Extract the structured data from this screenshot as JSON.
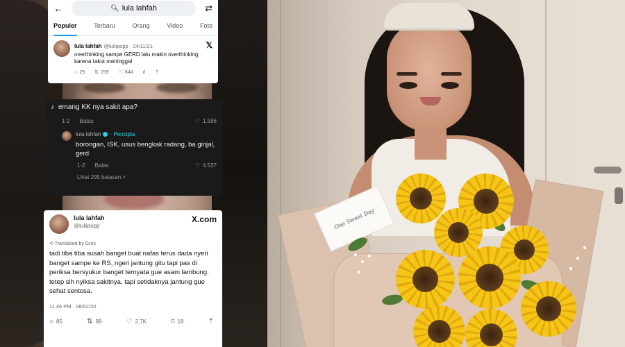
{
  "search_card": {
    "query": "lula lahfah",
    "tabs": [
      "Populer",
      "Terbaru",
      "Orang",
      "Video",
      "Foto"
    ],
    "tweet": {
      "name": "lula lahfah",
      "handle_date": "@lullipopp · 24/11/21",
      "text": "overthinking sampe GERD lalu makin overthinking karena takut meninggal",
      "replies": "29",
      "retweets": "259",
      "likes": "644"
    }
  },
  "reply_card": {
    "question": "emang KK nya sakit apa?",
    "question_age": "1-2",
    "reply_label": "Balas",
    "question_likes": "1.586",
    "creator_name": "lula lahfah",
    "creator_tag": "· Pencipta",
    "creator_text": "borongan, ISK, usus bengkak radang, ba ginjal, gerd",
    "creator_age": "1-2",
    "creator_likes": "4.537",
    "more_replies": "Lihat 295 balasan ˅"
  },
  "x_card": {
    "name": "lula lahfah",
    "handle": "@lullipopp",
    "brand": "X.com",
    "grok": "Translated by Grok",
    "text": "tadi tiba tiba susah banget buat nafas terus dada nyeri banget sampe ke RS, ngeri jantung gitu tapi pas di periksa bersyukur banget ternyata gue asam lambung. tetep sih nyiksa sakitnya, tapi setidaknya jantung gue sehat sentosa.",
    "time": "11.46 PM · 08/02/20",
    "replies": "85",
    "retweets": "99",
    "likes": "2,7K",
    "bookmarks": "18"
  },
  "photo": {
    "card_text": "One Sweet Day"
  },
  "colors": {
    "x_blue": "#1d9bf0",
    "tiktok_cyan": "#20d5ec",
    "dark_card": "#1a1a1a",
    "sunflower": "#f5c518"
  },
  "icons": [
    "back-arrow-icon",
    "search-icon",
    "filter-icon",
    "x-logo-icon",
    "reply-icon",
    "retweet-icon",
    "heart-icon",
    "views-icon",
    "bookmark-icon",
    "share-icon",
    "tiktok-icon",
    "verified-icon"
  ]
}
